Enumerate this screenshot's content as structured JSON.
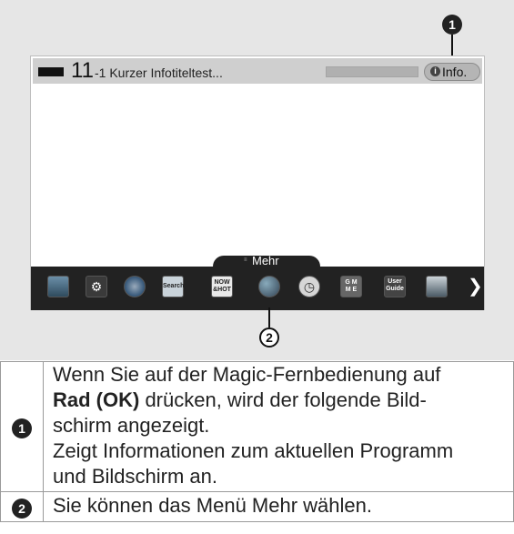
{
  "screen": {
    "channel_number": "11",
    "channel_suffix": "-1 Kurzer Infotiteltest...",
    "info_button": "Info.",
    "info_glyph": "i",
    "more_tab_label": "Mehr",
    "dock_icons": [
      "tv-guide-icon",
      "settings-icon",
      "internet-icon",
      "search-icon",
      "now-and-hot-icon",
      "apps-icon",
      "clock-icon",
      "game-icon",
      "user-guide-icon",
      "input-icon"
    ],
    "dock_texts": {
      "search": "Search",
      "now": "NOW\n&HOT",
      "game": "G M\nM E",
      "guide": "User\nGuide"
    }
  },
  "callouts": {
    "one": "1",
    "two": "2"
  },
  "table": {
    "row1": {
      "number": "1",
      "line1": "Wenn Sie auf der Magic-Fernbedienung auf",
      "bold": "Rad (OK)",
      "line2": " drücken, wird der folgende Bild-",
      "line3": "schirm angezeigt.",
      "line4": "Zeigt Informationen zum aktuellen Programm",
      "line5": "und Bildschirm an."
    },
    "row2": {
      "number": "2",
      "text": "Sie können das Menü Mehr wählen."
    }
  },
  "colors": {
    "figure_bg": "#e6e6e6",
    "dock_bg": "#222222",
    "bar_bg": "#cfcfcf"
  }
}
